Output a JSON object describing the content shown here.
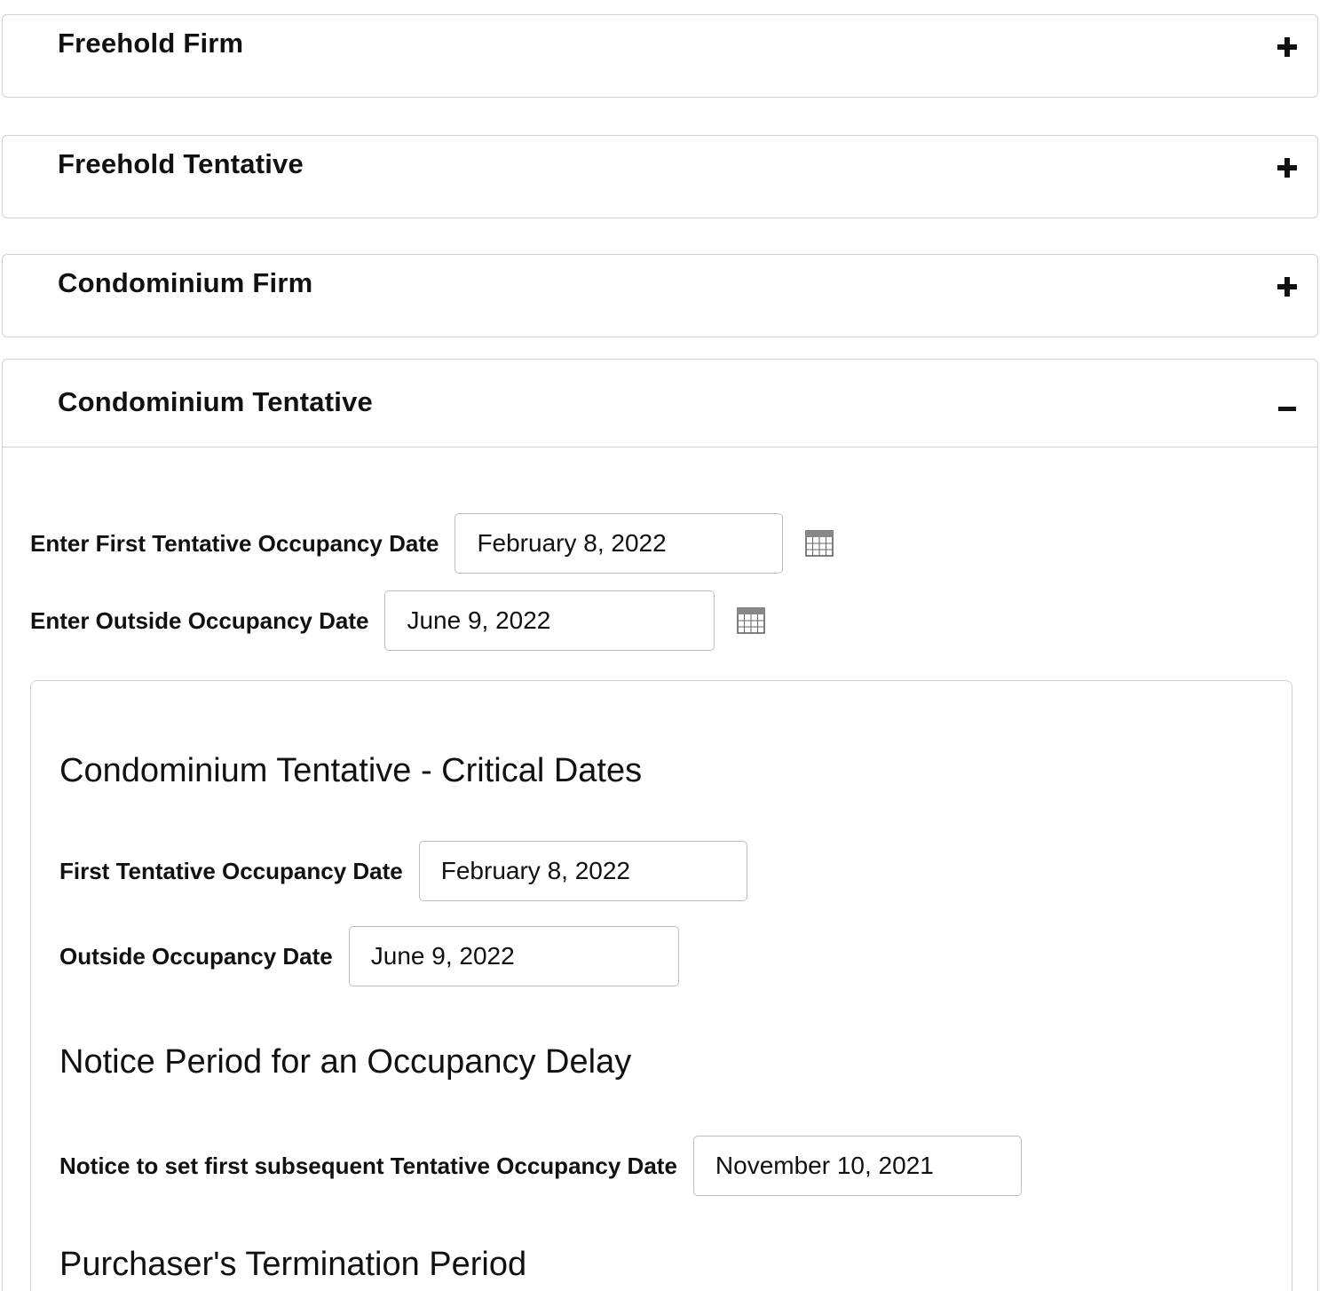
{
  "accordion": {
    "items": [
      {
        "title": "Freehold Firm",
        "toggle": "+"
      },
      {
        "title": "Freehold Tentative",
        "toggle": "+"
      },
      {
        "title": "Condominium Firm",
        "toggle": "+"
      },
      {
        "title": "Condominium Tentative",
        "toggle": "−"
      }
    ]
  },
  "form": {
    "first_tentative_label": "Enter First Tentative Occupancy Date",
    "first_tentative_value": "February 8, 2022",
    "outside_label": "Enter Outside Occupancy Date",
    "outside_value": "June 9, 2022"
  },
  "critical": {
    "title": "Condominium Tentative - Critical Dates",
    "first_label": "First Tentative Occupancy Date",
    "first_value": "February 8, 2022",
    "outside_label": "Outside Occupancy Date",
    "outside_value": "June 9, 2022"
  },
  "notice": {
    "title": "Notice Period for an Occupancy Delay",
    "label": "Notice to set first subsequent Tentative Occupancy Date",
    "value": "November 10, 2021"
  },
  "termination": {
    "title": "Purchaser's Termination Period"
  }
}
